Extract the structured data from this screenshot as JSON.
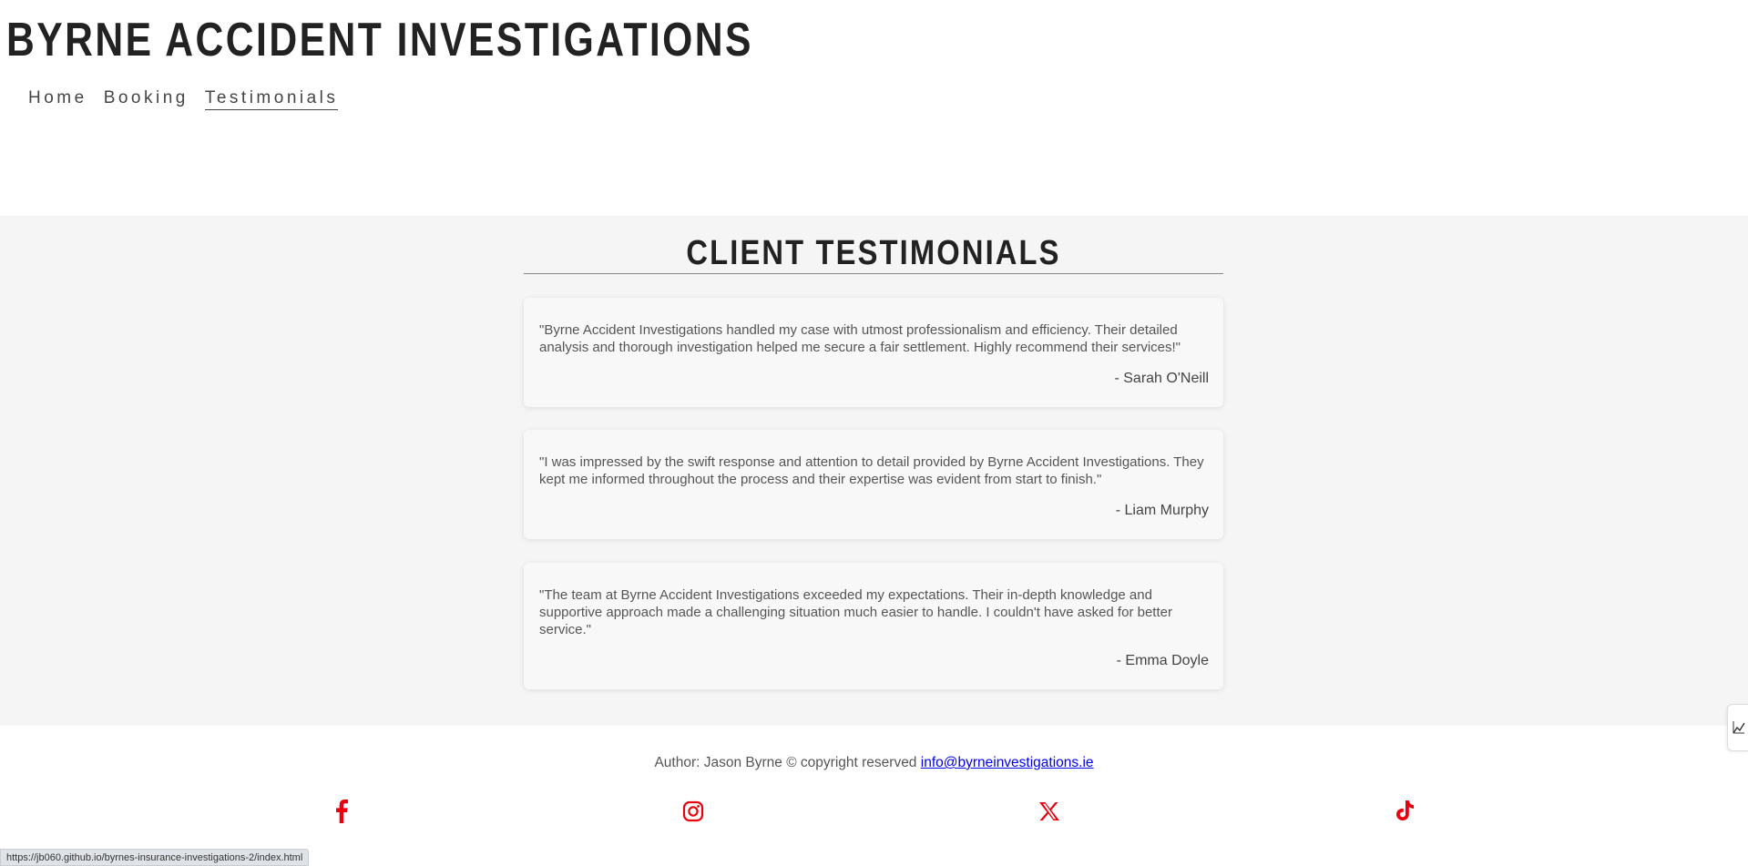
{
  "header": {
    "title": "BYRNE ACCIDENT INVESTIGATIONS",
    "nav": [
      {
        "label": "Home",
        "active": false
      },
      {
        "label": "Booking",
        "active": false
      },
      {
        "label": "Testimonials",
        "active": true
      }
    ]
  },
  "testimonials": {
    "heading": "CLIENT TESTIMONIALS",
    "items": [
      {
        "quote": "\"Byrne Accident Investigations handled my case with utmost professionalism and efficiency. Their detailed analysis and thorough investigation helped me secure a fair settlement. Highly recommend their services!\"",
        "author": "- Sarah O'Neill"
      },
      {
        "quote": "\"I was impressed by the swift response and attention to detail provided by Byrne Accident Investigations. They kept me informed throughout the process and their expertise was evident from start to finish.\"",
        "author": "- Liam Murphy"
      },
      {
        "quote": "\"The team at Byrne Accident Investigations exceeded my expectations. Their in-depth knowledge and supportive approach made a challenging situation much easier to handle. I couldn't have asked for better service.\"",
        "author": "- Emma Doyle"
      }
    ]
  },
  "footer": {
    "author_text": "Author: Jason Byrne © copyright reserved ",
    "email": "info@byrneinvestigations.ie",
    "social_icons": [
      "facebook-icon",
      "instagram-icon",
      "x-icon",
      "tiktok-icon"
    ],
    "icon_color": "#e8000e"
  },
  "status_bar": {
    "url": "https://jb060.github.io/byrnes-insurance-investigations-2/index.html"
  }
}
